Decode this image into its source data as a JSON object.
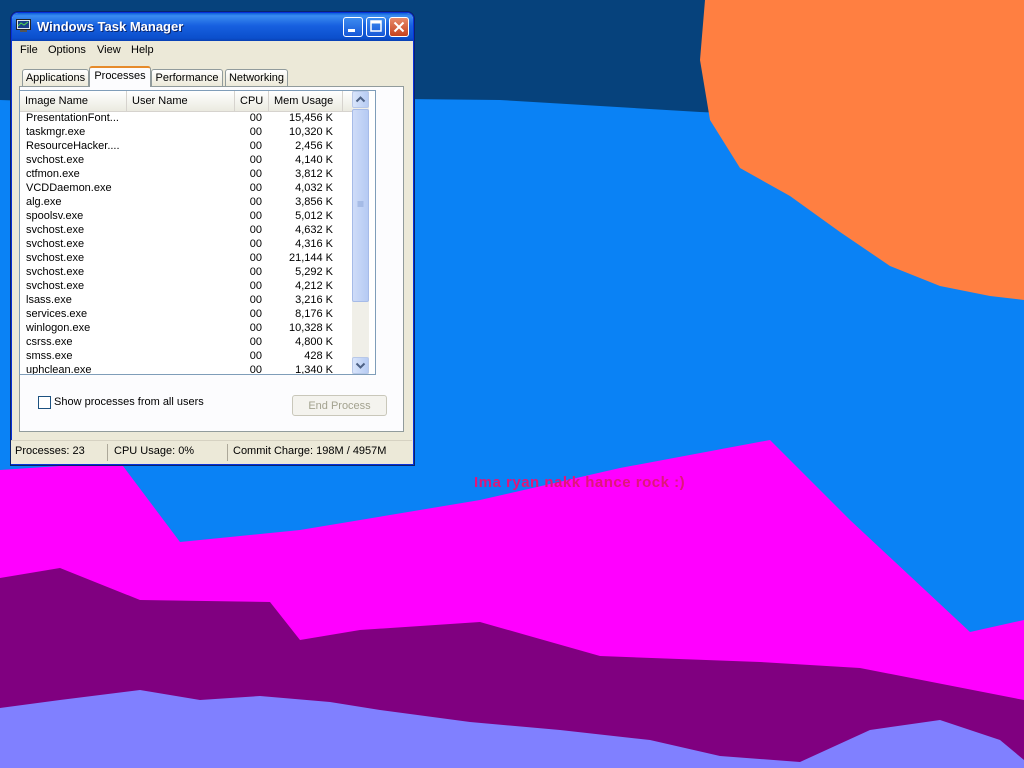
{
  "desktop": {
    "wallpaper_text": "Ima ryan nakk hance rock :)",
    "colors": {
      "dark_blue": "#06427c",
      "light_blue": "#0a82f5",
      "orange": "#ff7f41",
      "magenta": "#ff00ff",
      "purple": "#800080",
      "lavender": "#8080ff"
    }
  },
  "window": {
    "title": "Windows Task Manager",
    "title_icon": "task-manager-icon",
    "controls": {
      "minimize": "minimize-icon",
      "maximize": "maximize-icon",
      "close": "close-icon"
    },
    "menu": [
      "File",
      "Options",
      "View",
      "Help"
    ],
    "tabs": [
      {
        "label": "Applications",
        "active": false
      },
      {
        "label": "Processes",
        "active": true
      },
      {
        "label": "Performance",
        "active": false
      },
      {
        "label": "Networking",
        "active": false
      }
    ],
    "process_table": {
      "columns": [
        "Image Name",
        "User Name",
        "CPU",
        "Mem Usage"
      ],
      "rows": [
        [
          "PresentationFont...",
          "",
          "00",
          "15,456 K"
        ],
        [
          "taskmgr.exe",
          "",
          "00",
          "10,320 K"
        ],
        [
          "ResourceHacker....",
          "",
          "00",
          "2,456 K"
        ],
        [
          "svchost.exe",
          "",
          "00",
          "4,140 K"
        ],
        [
          "ctfmon.exe",
          "",
          "00",
          "3,812 K"
        ],
        [
          "VCDDaemon.exe",
          "",
          "00",
          "4,032 K"
        ],
        [
          "alg.exe",
          "",
          "00",
          "3,856 K"
        ],
        [
          "spoolsv.exe",
          "",
          "00",
          "5,012 K"
        ],
        [
          "svchost.exe",
          "",
          "00",
          "4,632 K"
        ],
        [
          "svchost.exe",
          "",
          "00",
          "4,316 K"
        ],
        [
          "svchost.exe",
          "",
          "00",
          "21,144 K"
        ],
        [
          "svchost.exe",
          "",
          "00",
          "5,292 K"
        ],
        [
          "svchost.exe",
          "",
          "00",
          "4,212 K"
        ],
        [
          "lsass.exe",
          "",
          "00",
          "3,216 K"
        ],
        [
          "services.exe",
          "",
          "00",
          "8,176 K"
        ],
        [
          "winlogon.exe",
          "",
          "00",
          "10,328 K"
        ],
        [
          "csrss.exe",
          "",
          "00",
          "4,800 K"
        ],
        [
          "smss.exe",
          "",
          "00",
          "428 K"
        ],
        [
          "uphclean.exe",
          "",
          "00",
          "1,340 K"
        ]
      ]
    },
    "show_all_users_label": "Show processes from all users",
    "show_all_users_checked": false,
    "end_process_label": "End Process",
    "status": {
      "processes": "Processes: 23",
      "cpu": "CPU Usage: 0%",
      "commit": "Commit Charge: 198M / 4957M"
    }
  }
}
